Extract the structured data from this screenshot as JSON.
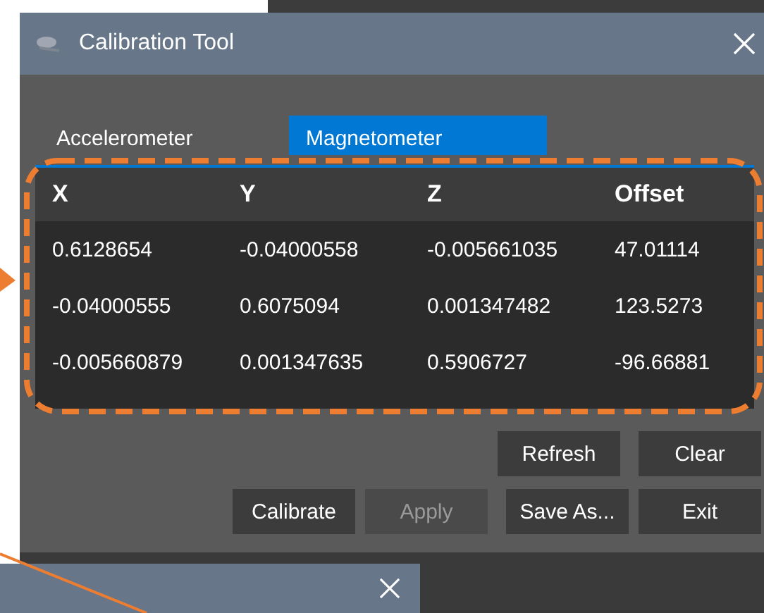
{
  "window": {
    "title": "Calibration Tool"
  },
  "tabs": [
    {
      "label": "Accelerometer",
      "selected": false
    },
    {
      "label": "Magnetometer",
      "selected": true
    }
  ],
  "table": {
    "columns": [
      "X",
      "Y",
      "Z",
      "Offset"
    ],
    "rows": [
      [
        "0.6128654",
        "-0.04000558",
        "-0.005661035",
        "47.01114"
      ],
      [
        "-0.04000555",
        "0.6075094",
        "0.001347482",
        "123.5273"
      ],
      [
        "-0.005660879",
        "0.001347635",
        "0.5906727",
        "-96.66881"
      ]
    ]
  },
  "buttons": [
    [
      {
        "label": "Refresh",
        "disabled": false
      },
      {
        "label": "Clear",
        "disabled": false
      }
    ],
    [
      {
        "label": "Calibrate",
        "disabled": false
      },
      {
        "label": "Apply",
        "disabled": true
      },
      {
        "label": "Save As...",
        "disabled": false
      },
      {
        "label": "Exit",
        "disabled": false
      }
    ]
  ]
}
